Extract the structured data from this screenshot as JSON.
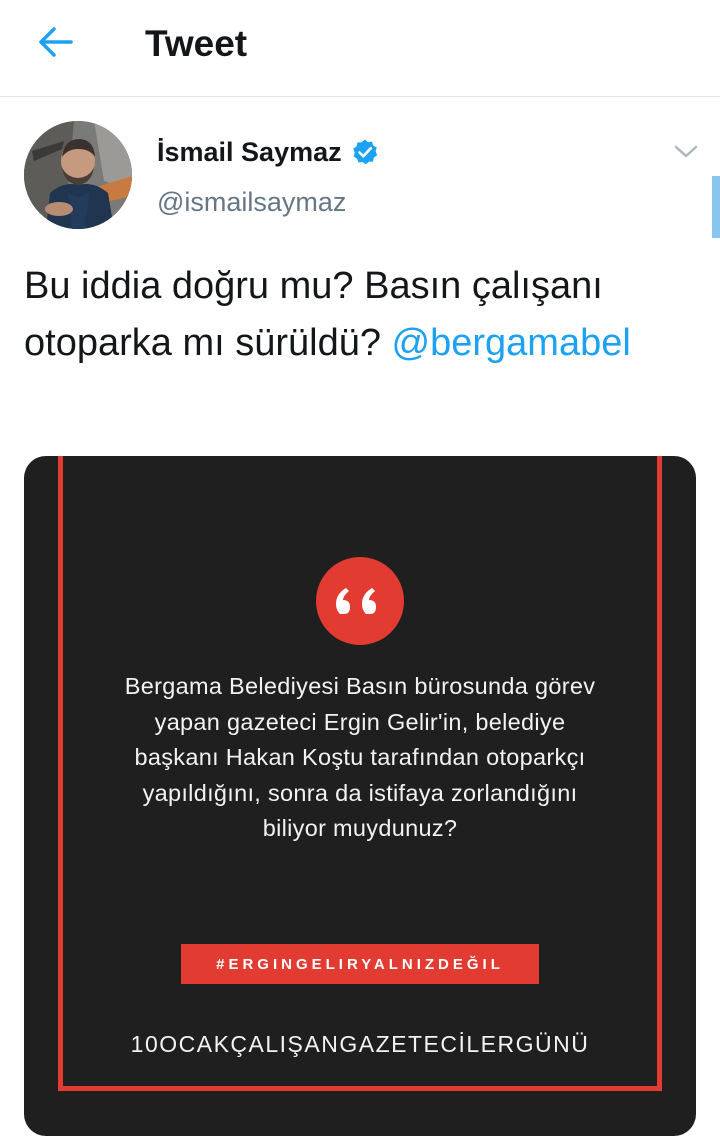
{
  "header": {
    "back_icon": "arrow-left-icon",
    "title": "Tweet"
  },
  "author": {
    "name": "İsmail Saymaz",
    "handle": "@ismailsaymaz",
    "verified_icon": "verified-badge-icon",
    "menu_icon": "chevron-down-icon"
  },
  "tweet": {
    "text": "Bu iddia doğru mu? Basın çalışanı otoparka mı sürüldü? ",
    "mention": "@bergamabel"
  },
  "media": {
    "quote_icon": "quote-icon",
    "quote_text": "Bergama Belediyesi Basın bürosunda görev yapan gazeteci Ergin Gelir'in, belediye başkanı Hakan Koştu tarafından otoparkçı yapıldığını, sonra da istifaya zorlandığını biliyor muydunuz?",
    "hashtag": "#ERGINGELIRYALNIZDEĞIL",
    "bottom_tag": "10OCAKÇALIŞANGAZETECİLERGÜNÜ"
  },
  "colors": {
    "accent": "#1da1f2",
    "text_primary": "#14171a",
    "text_secondary": "#657786",
    "card_background": "#1f1f1f",
    "card_red": "#e23b32"
  }
}
